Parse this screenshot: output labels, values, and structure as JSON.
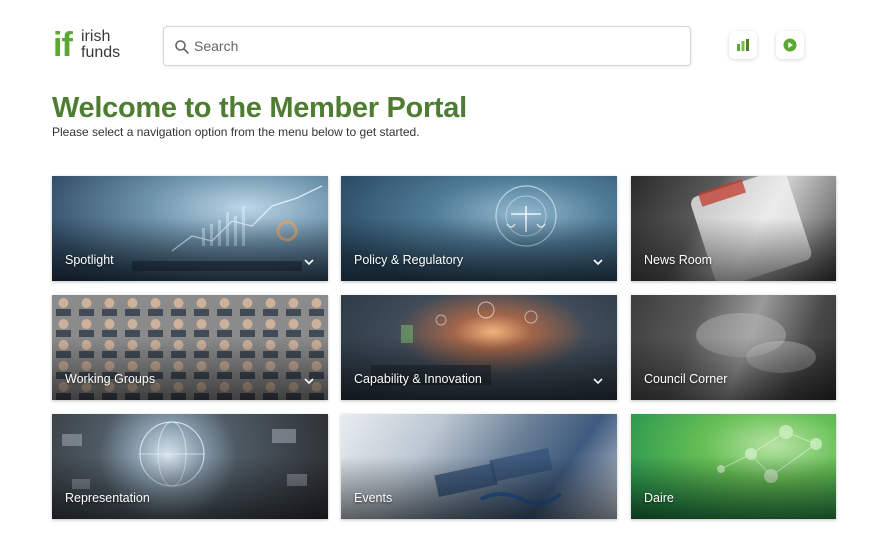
{
  "header": {
    "logo": {
      "mark": "if",
      "line1": "irish",
      "line2": "funds"
    },
    "search": {
      "placeholder": "Search",
      "value": ""
    },
    "buttons": [
      {
        "icon": "bar-chart-icon",
        "color": "#5aa832"
      },
      {
        "icon": "play-icon",
        "color": "#5aa832"
      }
    ]
  },
  "main": {
    "title": "Welcome to the Member Portal",
    "subtitle": "Please select a navigation option from the menu below to get started."
  },
  "tiles": [
    {
      "label": "Spotlight",
      "has_dropdown": true
    },
    {
      "label": "Policy & Regulatory",
      "has_dropdown": true
    },
    {
      "label": "News Room",
      "has_dropdown": false
    },
    {
      "label": "Working Groups",
      "has_dropdown": true
    },
    {
      "label": "Capability & Innovation",
      "has_dropdown": true
    },
    {
      "label": "Council Corner",
      "has_dropdown": false
    },
    {
      "label": "Representation",
      "has_dropdown": false
    },
    {
      "label": "Events",
      "has_dropdown": false
    },
    {
      "label": "Daire",
      "has_dropdown": false
    }
  ],
  "colors": {
    "brand_green": "#5aa832",
    "title_green": "#4e7d32"
  }
}
